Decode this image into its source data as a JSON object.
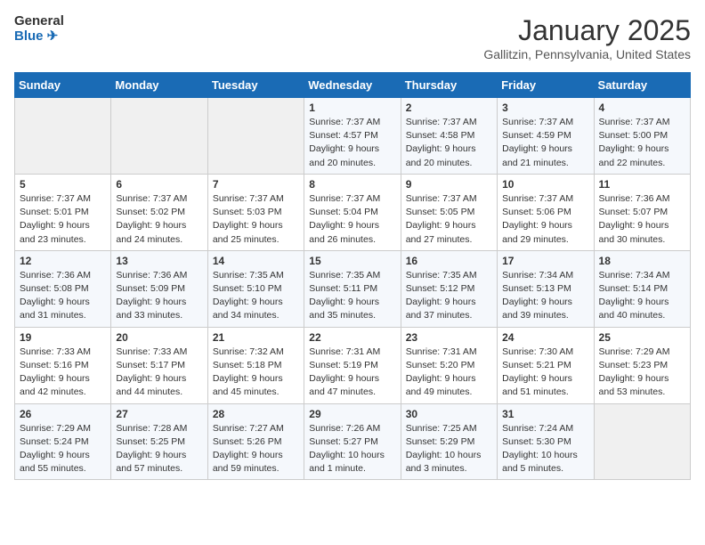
{
  "logo": {
    "line1": "General",
    "line2": "Blue"
  },
  "title": "January 2025",
  "location": "Gallitzin, Pennsylvania, United States",
  "days_of_week": [
    "Sunday",
    "Monday",
    "Tuesday",
    "Wednesday",
    "Thursday",
    "Friday",
    "Saturday"
  ],
  "weeks": [
    [
      {
        "day": "",
        "info": ""
      },
      {
        "day": "",
        "info": ""
      },
      {
        "day": "",
        "info": ""
      },
      {
        "day": "1",
        "info": "Sunrise: 7:37 AM\nSunset: 4:57 PM\nDaylight: 9 hours\nand 20 minutes."
      },
      {
        "day": "2",
        "info": "Sunrise: 7:37 AM\nSunset: 4:58 PM\nDaylight: 9 hours\nand 20 minutes."
      },
      {
        "day": "3",
        "info": "Sunrise: 7:37 AM\nSunset: 4:59 PM\nDaylight: 9 hours\nand 21 minutes."
      },
      {
        "day": "4",
        "info": "Sunrise: 7:37 AM\nSunset: 5:00 PM\nDaylight: 9 hours\nand 22 minutes."
      }
    ],
    [
      {
        "day": "5",
        "info": "Sunrise: 7:37 AM\nSunset: 5:01 PM\nDaylight: 9 hours\nand 23 minutes."
      },
      {
        "day": "6",
        "info": "Sunrise: 7:37 AM\nSunset: 5:02 PM\nDaylight: 9 hours\nand 24 minutes."
      },
      {
        "day": "7",
        "info": "Sunrise: 7:37 AM\nSunset: 5:03 PM\nDaylight: 9 hours\nand 25 minutes."
      },
      {
        "day": "8",
        "info": "Sunrise: 7:37 AM\nSunset: 5:04 PM\nDaylight: 9 hours\nand 26 minutes."
      },
      {
        "day": "9",
        "info": "Sunrise: 7:37 AM\nSunset: 5:05 PM\nDaylight: 9 hours\nand 27 minutes."
      },
      {
        "day": "10",
        "info": "Sunrise: 7:37 AM\nSunset: 5:06 PM\nDaylight: 9 hours\nand 29 minutes."
      },
      {
        "day": "11",
        "info": "Sunrise: 7:36 AM\nSunset: 5:07 PM\nDaylight: 9 hours\nand 30 minutes."
      }
    ],
    [
      {
        "day": "12",
        "info": "Sunrise: 7:36 AM\nSunset: 5:08 PM\nDaylight: 9 hours\nand 31 minutes."
      },
      {
        "day": "13",
        "info": "Sunrise: 7:36 AM\nSunset: 5:09 PM\nDaylight: 9 hours\nand 33 minutes."
      },
      {
        "day": "14",
        "info": "Sunrise: 7:35 AM\nSunset: 5:10 PM\nDaylight: 9 hours\nand 34 minutes."
      },
      {
        "day": "15",
        "info": "Sunrise: 7:35 AM\nSunset: 5:11 PM\nDaylight: 9 hours\nand 35 minutes."
      },
      {
        "day": "16",
        "info": "Sunrise: 7:35 AM\nSunset: 5:12 PM\nDaylight: 9 hours\nand 37 minutes."
      },
      {
        "day": "17",
        "info": "Sunrise: 7:34 AM\nSunset: 5:13 PM\nDaylight: 9 hours\nand 39 minutes."
      },
      {
        "day": "18",
        "info": "Sunrise: 7:34 AM\nSunset: 5:14 PM\nDaylight: 9 hours\nand 40 minutes."
      }
    ],
    [
      {
        "day": "19",
        "info": "Sunrise: 7:33 AM\nSunset: 5:16 PM\nDaylight: 9 hours\nand 42 minutes."
      },
      {
        "day": "20",
        "info": "Sunrise: 7:33 AM\nSunset: 5:17 PM\nDaylight: 9 hours\nand 44 minutes."
      },
      {
        "day": "21",
        "info": "Sunrise: 7:32 AM\nSunset: 5:18 PM\nDaylight: 9 hours\nand 45 minutes."
      },
      {
        "day": "22",
        "info": "Sunrise: 7:31 AM\nSunset: 5:19 PM\nDaylight: 9 hours\nand 47 minutes."
      },
      {
        "day": "23",
        "info": "Sunrise: 7:31 AM\nSunset: 5:20 PM\nDaylight: 9 hours\nand 49 minutes."
      },
      {
        "day": "24",
        "info": "Sunrise: 7:30 AM\nSunset: 5:21 PM\nDaylight: 9 hours\nand 51 minutes."
      },
      {
        "day": "25",
        "info": "Sunrise: 7:29 AM\nSunset: 5:23 PM\nDaylight: 9 hours\nand 53 minutes."
      }
    ],
    [
      {
        "day": "26",
        "info": "Sunrise: 7:29 AM\nSunset: 5:24 PM\nDaylight: 9 hours\nand 55 minutes."
      },
      {
        "day": "27",
        "info": "Sunrise: 7:28 AM\nSunset: 5:25 PM\nDaylight: 9 hours\nand 57 minutes."
      },
      {
        "day": "28",
        "info": "Sunrise: 7:27 AM\nSunset: 5:26 PM\nDaylight: 9 hours\nand 59 minutes."
      },
      {
        "day": "29",
        "info": "Sunrise: 7:26 AM\nSunset: 5:27 PM\nDaylight: 10 hours\nand 1 minute."
      },
      {
        "day": "30",
        "info": "Sunrise: 7:25 AM\nSunset: 5:29 PM\nDaylight: 10 hours\nand 3 minutes."
      },
      {
        "day": "31",
        "info": "Sunrise: 7:24 AM\nSunset: 5:30 PM\nDaylight: 10 hours\nand 5 minutes."
      },
      {
        "day": "",
        "info": ""
      }
    ]
  ]
}
